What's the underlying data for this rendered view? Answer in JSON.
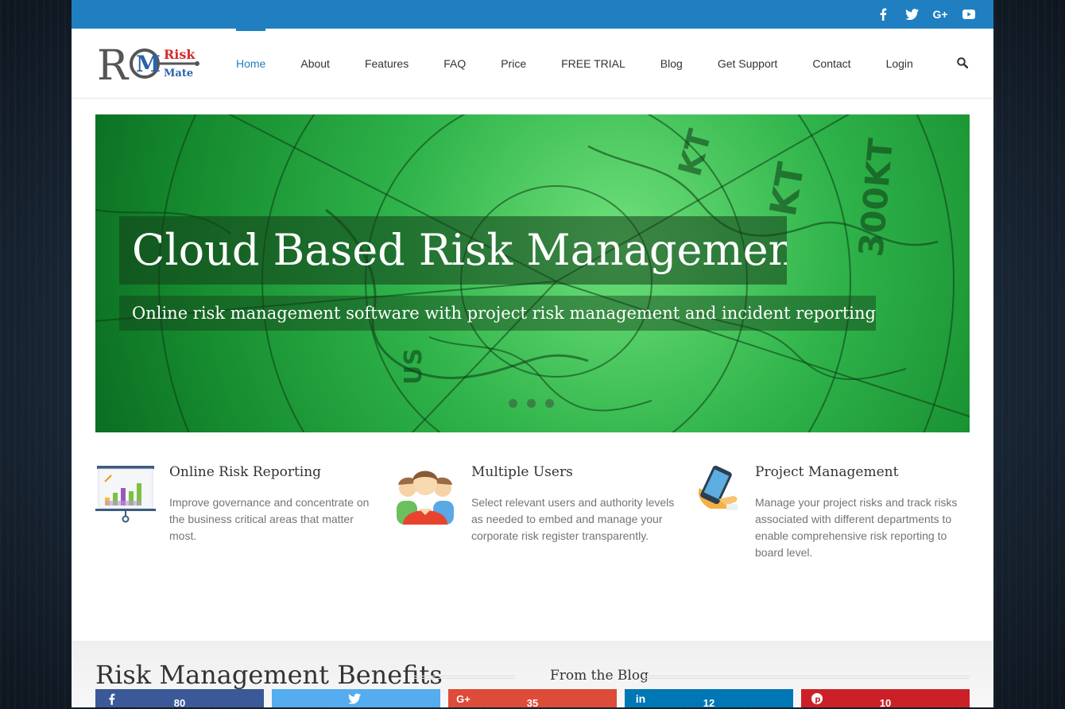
{
  "topbar": {
    "social": [
      {
        "name": "facebook-icon",
        "glyph": "f"
      },
      {
        "name": "twitter-icon",
        "glyph": "t"
      },
      {
        "name": "google-plus-icon",
        "glyph": "G+"
      },
      {
        "name": "youtube-icon",
        "glyph": "yt"
      }
    ],
    "color": "#1f7fc0"
  },
  "logo": {
    "letters": "RM",
    "word1": "Risk",
    "word2": "Mate"
  },
  "nav": {
    "items": [
      {
        "label": "Home",
        "active": true
      },
      {
        "label": "About"
      },
      {
        "label": "Features"
      },
      {
        "label": "FAQ"
      },
      {
        "label": "Price"
      },
      {
        "label": "FREE TRIAL"
      },
      {
        "label": "Blog"
      },
      {
        "label": "Get Support"
      },
      {
        "label": "Contact"
      },
      {
        "label": "Login"
      }
    ],
    "search_icon": "search-icon"
  },
  "hero": {
    "title": "Cloud Based Risk Management",
    "subtitle": "Online risk management software with project risk management and incident reporting",
    "slides": 3,
    "active_slide": 1
  },
  "features": [
    {
      "icon": "chart-board-icon",
      "title": "Online Risk Reporting",
      "text": "Improve governance and concentrate on the business critical areas that matter most."
    },
    {
      "icon": "users-group-icon",
      "title": "Multiple Users",
      "text": "Select relevant users and authority levels as needed to embed and manage your corporate risk register transparently."
    },
    {
      "icon": "phone-hand-icon",
      "title": "Project Management",
      "text": "Manage your project risks and track risks associated with different departments to enable comprehensive risk reporting to board level."
    }
  ],
  "benefits": {
    "title": "Risk Management Benefits",
    "blog_title": "From the Blog"
  },
  "share": [
    {
      "network": "facebook",
      "icon": "facebook-icon",
      "count": "80",
      "color": "#3b5998"
    },
    {
      "network": "twitter",
      "icon": "twitter-icon",
      "count": "",
      "color": "#55acee"
    },
    {
      "network": "google-plus",
      "icon": "google-plus-icon",
      "count": "35",
      "color": "#dd4b39"
    },
    {
      "network": "linkedin",
      "icon": "linkedin-icon",
      "count": "12",
      "color": "#0077b5"
    },
    {
      "network": "pinterest",
      "icon": "pinterest-icon",
      "count": "10",
      "color": "#cb2027"
    }
  ]
}
